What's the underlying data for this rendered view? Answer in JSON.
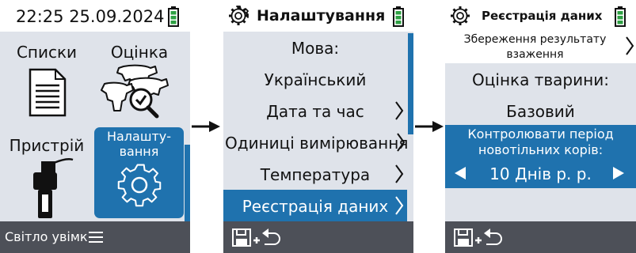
{
  "screen1": {
    "clock": "22:25 25.09.2024",
    "tiles": {
      "lists": "Списки",
      "evaluation": "Оцінка",
      "device": "Пристрій",
      "settings_line1": "Налашту-",
      "settings_line2": "вання"
    },
    "bottom_label": "Світло увімк"
  },
  "screen2": {
    "title": "Налаштування",
    "items": {
      "language_label": "Мова:",
      "language_value": "Український",
      "datetime": "Дата та час",
      "units": "Одиниці вимірювання",
      "temperature": "Температура",
      "data_recording": "Реєстрація даних"
    }
  },
  "screen3": {
    "title": "Реєстрація даних",
    "save_result_line1": "Збереження результату",
    "save_result_line2": "взаження",
    "animal_eval_label": "Оцінка тварини:",
    "animal_eval_value": "Базовий",
    "monitor_line1": "Контролювати період",
    "monitor_line2": "новотільних корів:",
    "monitor_value": "10 Днів р. р."
  },
  "colors": {
    "accent": "#1f72ae",
    "panel": "#dfe3ea",
    "bottom_bar": "#4d5058",
    "battery": "#2ea043"
  }
}
